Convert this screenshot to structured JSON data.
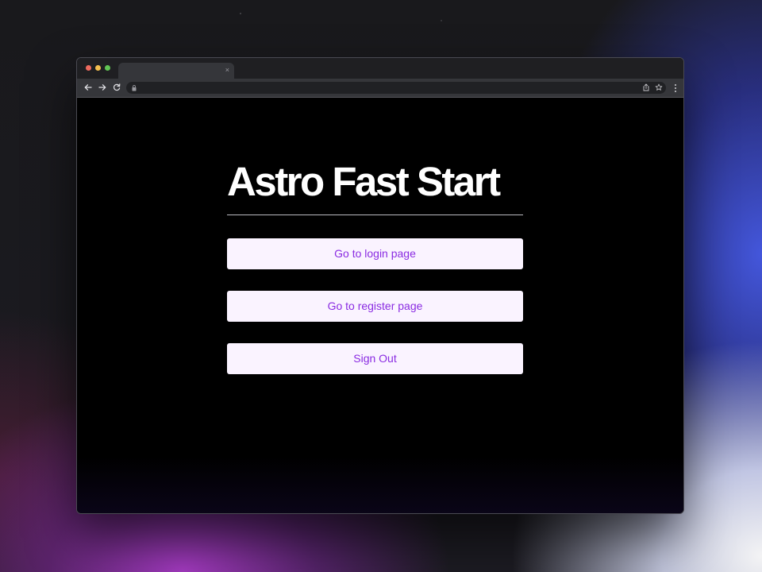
{
  "browser": {
    "tab_close_glyph": "×",
    "icons": {
      "back": "arrow-left-icon",
      "forward": "arrow-right-icon",
      "reload": "reload-icon",
      "lock": "lock-icon",
      "share": "share-icon",
      "bookmark": "star-icon",
      "menu": "kebab-menu-icon"
    }
  },
  "page": {
    "title": "Astro Fast Start",
    "buttons": [
      {
        "label": "Go to login page"
      },
      {
        "label": "Go to register page"
      },
      {
        "label": "Sign Out"
      }
    ]
  },
  "colors": {
    "page_background": "#000000",
    "button_background": "#faf3ff",
    "button_text": "#8a2be2",
    "title_text": "#ffffff"
  }
}
